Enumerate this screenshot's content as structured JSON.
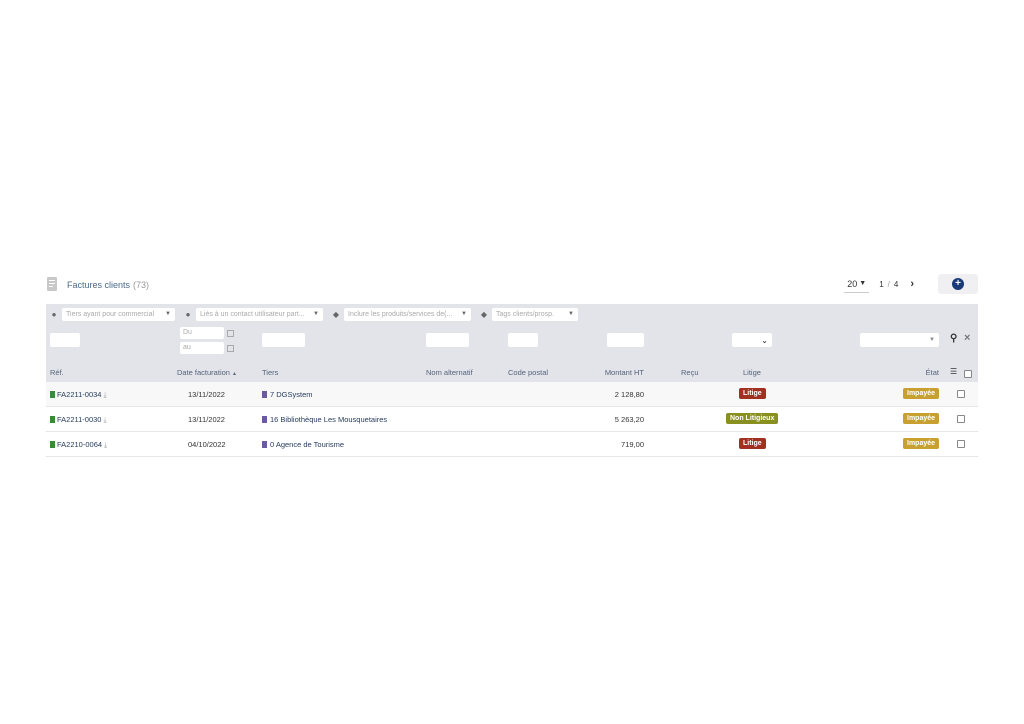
{
  "title": {
    "label": "Factures clients",
    "count": "(73)"
  },
  "pager": {
    "per_page": "20",
    "page": "1",
    "sep": "/",
    "total_pages": "4"
  },
  "filters": {
    "commercial_placeholder": "Tiers ayant pour commercial",
    "contact_placeholder": "Liés à un contact utilisateur part...",
    "products_placeholder": "Inclure les produits/services de(...",
    "tags_placeholder": "Tags clients/prosp.",
    "date_from_placeholder": "Du",
    "date_to_placeholder": "au"
  },
  "columns": {
    "ref": "Réf.",
    "date": "Date facturation",
    "sort_indicator": "▲",
    "tiers": "Tiers",
    "alt_name": "Nom alternatif",
    "postal": "Code postal",
    "amount": "Montant HT",
    "received": "Reçu",
    "litige": "Litige",
    "status": "État"
  },
  "rows": [
    {
      "ref": "FA2211-0034",
      "date": "13/11/2022",
      "tiers": "7 DGSystem",
      "amount": "2 128,80",
      "litige": "Litige",
      "status": "Impayée"
    },
    {
      "ref": "FA2211-0030",
      "date": "13/11/2022",
      "tiers": "16 Bibliothèque Les Mousquetaires",
      "amount": "5 263,20",
      "litige": "Non Litigieux",
      "status": "Impayée"
    },
    {
      "ref": "FA2210-0064",
      "date": "04/10/2022",
      "tiers": "0 Agence de Tourisme",
      "amount": "719,00",
      "litige": "Litige",
      "status": "Impayée"
    }
  ],
  "colors": {
    "litige": "#a03020",
    "non_litigieux": "#8a9020",
    "impayee": "#c8a030",
    "accent": "#1a3a7a"
  }
}
